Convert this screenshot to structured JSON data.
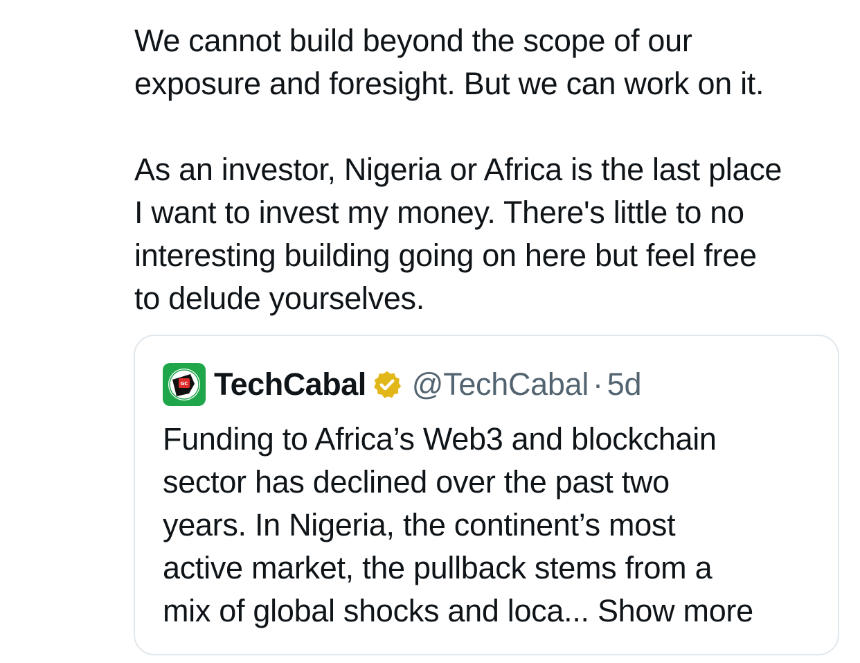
{
  "tweet": {
    "paragraph1_lines": [
      "We cannot build beyond the scope of our",
      "exposure and foresight. But we can work on it."
    ],
    "paragraph2_lines": [
      "As an investor, Nigeria or Africa is the last place",
      "I want to invest my money. There's little to no",
      "interesting building going on here but feel free",
      "to delude yourselves."
    ]
  },
  "quoted_tweet": {
    "display_name": "TechCabal",
    "handle": "@TechCabal",
    "separator": "·",
    "timestamp": "5d",
    "text_lines": [
      "Funding to Africa’s Web3 and blockchain",
      "sector has declined over the past two",
      "years. In Nigeria, the continent’s most",
      "active market, the pullback stems from a"
    ],
    "last_line_text": "mix of global shocks and loca... ",
    "show_more_label": "Show more",
    "avatar_icon": "techcabal-logo-icon",
    "verified_icon": "verified-badge-icon"
  },
  "colors": {
    "text_primary": "#0f1419",
    "text_secondary": "#536471",
    "border": "#e1e8ed",
    "verified_gold": "#e2b719",
    "avatar_green": "#1fa64a",
    "avatar_red": "#e02b2b"
  }
}
